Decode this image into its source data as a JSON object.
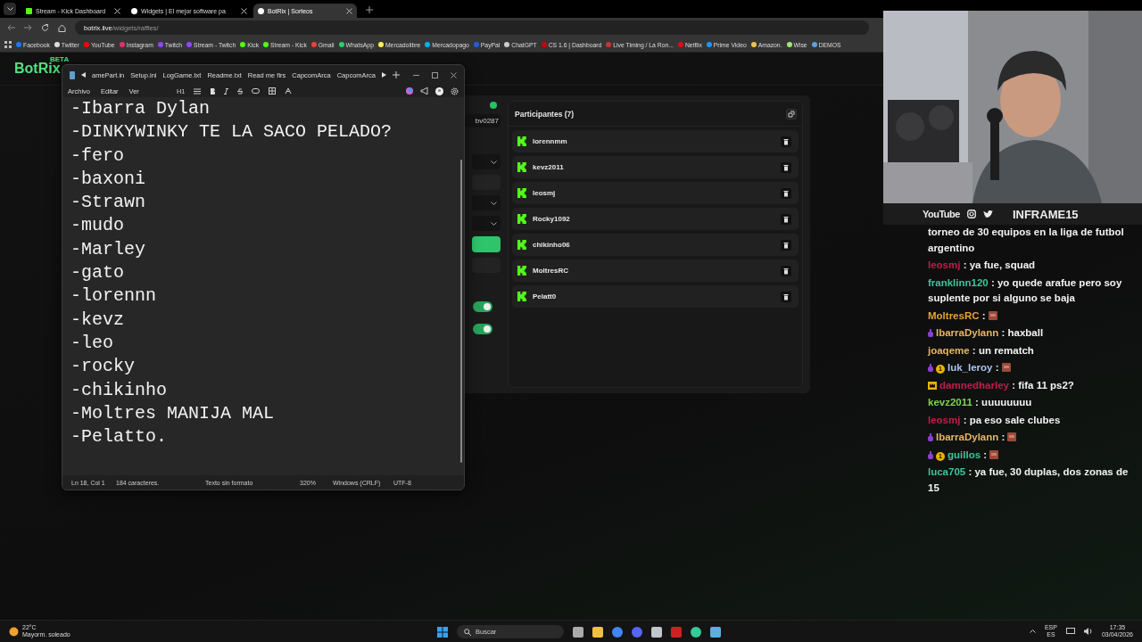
{
  "browser": {
    "tabs": [
      {
        "title": "Stream - Kick Dashboard",
        "selected": false
      },
      {
        "title": "Widgets | El mejor software pa",
        "selected": false
      },
      {
        "title": "BotRix | Sorteos",
        "selected": true
      }
    ],
    "url": {
      "domain": "botrix.live",
      "path": "/widgets/raffles/"
    },
    "bookmarks": [
      "Facebook",
      "Twitter",
      "YouTube",
      "Instagram",
      "Twitch",
      "Stream - Twitch",
      "Kick",
      "Stream - Kick",
      "Gmail",
      "WhatsApp",
      "Mercadolibre",
      "Mercadopago",
      "PayPal",
      "ChatGPT",
      "CS 1.6 | Dashboard",
      "Live Timing / La Ron...",
      "Netflix",
      "Prime Video",
      "Amazon.",
      "Wise",
      "DEMOS"
    ]
  },
  "botrix": {
    "logo": "BotRix",
    "badge": "BETA",
    "settings": {
      "field_value": "bv0287",
      "toggles": [
        {
          "on": true
        },
        {
          "on": true
        }
      ]
    },
    "participants": {
      "title": "Participantes (7)",
      "items": [
        "lorennmm",
        "kevz2011",
        "leosmj",
        "Rocky1092",
        "chikinho06",
        "MoltresRC",
        "Pelatt0"
      ]
    }
  },
  "notepad": {
    "tabs": [
      "amePart.in",
      "Setup.ini",
      "LogGame.txt",
      "Readme.txt",
      "Read me firs",
      "CapcomArca",
      "CapcomArca"
    ],
    "menu": [
      "Archivo",
      "Editar",
      "Ver"
    ],
    "heading_button": "H1",
    "lines": [
      "-Ibarra Dylan",
      "-DINKYWINKY TE LA SACO PELADO?",
      "-fero",
      "-baxoni",
      "-Strawn",
      "-mudo",
      "-Marley",
      "-gato",
      "-lorennn",
      "-kevz",
      "-leo",
      "-rocky",
      "-chikinho",
      "-Moltres MANIJA MAL",
      "-Pelatto."
    ],
    "status": [
      "Ln 18, Col 1",
      "184 caracteres.",
      "Texto sin formato",
      "320%",
      "Windows (CRLF)",
      "UTF-8"
    ]
  },
  "stream_overlay": {
    "platform": "YouTube",
    "channel": "INFRAME15"
  },
  "chat": [
    {
      "kind": "text",
      "text": "torneo de 30 equipos en la liga de futbol argentino"
    },
    {
      "user": "leosmj",
      "color": "#c21d4e",
      "kind": "text",
      "text": ": ya fue, squad"
    },
    {
      "user": "franklinn120",
      "color": "#40c29a",
      "kind": "text",
      "text": ": yo quede arafue pero soy suplente por si alguno se baja"
    },
    {
      "user": "MoltresRC",
      "color": "#e3a23a",
      "kind": "emote",
      "text": ":"
    },
    {
      "user": "IbarraDylann",
      "color": "#e6b564",
      "kind": "text",
      "text": ": haxball",
      "badges": [
        {
          "kind": "gift"
        }
      ]
    },
    {
      "user": "joaqeme",
      "color": "#e6b564",
      "kind": "text",
      "text": ": un rematch"
    },
    {
      "user": "luk_leroy",
      "color": "#a9c2ef",
      "kind": "emote",
      "text": ":",
      "badges": [
        {
          "kind": "gift"
        },
        {
          "kind": "tier",
          "label": "1"
        }
      ]
    },
    {
      "user": "damnedharley",
      "color": "#c21d4e",
      "kind": "text",
      "text": ": fifa 11 ps2?",
      "badges": [
        {
          "kind": "crown"
        }
      ]
    },
    {
      "user": "kevz2011",
      "color": "#7ed44e",
      "kind": "text",
      "text": ": uuuuuuuu"
    },
    {
      "user": "leosmj",
      "color": "#c21d4e",
      "kind": "text",
      "text": ": pa eso sale clubes"
    },
    {
      "user": "IbarraDylann",
      "color": "#e6b564",
      "kind": "emote",
      "text": ":",
      "badges": [
        {
          "kind": "gift"
        }
      ]
    },
    {
      "user": "guillos",
      "color": "#40c29a",
      "kind": "emote",
      "text": ":",
      "badges": [
        {
          "kind": "gift"
        },
        {
          "kind": "tier",
          "label": "1"
        }
      ]
    },
    {
      "user": "luca705",
      "color": "#40c29a",
      "kind": "text",
      "text": ": ya fue, 30 duplas, dos zonas de 15"
    }
  ],
  "taskbar": {
    "weather": {
      "temp": "22°C",
      "desc": "Mayorm. soleado"
    },
    "search_placeholder": "Buscar",
    "tray": {
      "lang": "ESP",
      "layout": "ES",
      "time": "17:35",
      "date": "03/04/2026"
    }
  }
}
